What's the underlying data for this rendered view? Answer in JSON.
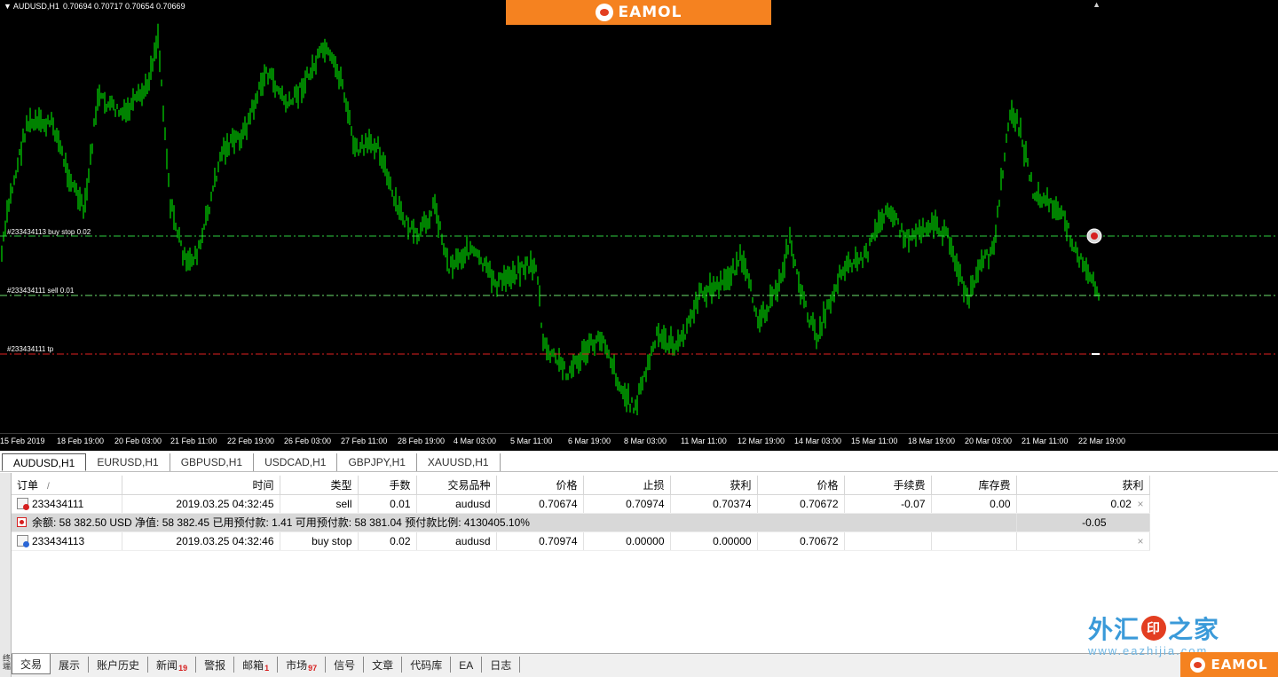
{
  "chart": {
    "symbol_label": "AUDUSD,H1",
    "quote": "0.70694 0.70717 0.70654 0.70669",
    "colors": {
      "background": "#000000",
      "bars": "#00c800",
      "order_line": "#2ecc40",
      "tp_line": "#e02020"
    },
    "order_lines": [
      {
        "label": "#233434113 buy stop 0.02",
        "color": "#2ecc40"
      },
      {
        "label": "#233434111 sell 0.01",
        "color": "#6ee06e"
      },
      {
        "label": "#233434111 tp",
        "color": "#e02020"
      }
    ],
    "time_axis": [
      "15 Feb 2019",
      "18 Feb 19:00",
      "20 Feb 03:00",
      "21 Feb 11:00",
      "22 Feb 19:00",
      "26 Feb 03:00",
      "27 Feb 11:00",
      "28 Feb 19:00",
      "4 Mar 03:00",
      "5 Mar 11:00",
      "6 Mar 19:00",
      "8 Mar 03:00",
      "11 Mar 11:00",
      "12 Mar 19:00",
      "14 Mar 03:00",
      "15 Mar 11:00",
      "18 Mar 19:00",
      "20 Mar 03:00",
      "21 Mar 11:00",
      "22 Mar 19:00"
    ]
  },
  "brand": {
    "name": "EAMOL",
    "color": "#f58220"
  },
  "chart_tabs": [
    "AUDUSD,H1",
    "EURUSD,H1",
    "GBPUSD,H1",
    "USDCAD,H1",
    "GBPJPY,H1",
    "XAUUSD,H1"
  ],
  "terminal": {
    "side_label": "终端",
    "columns": [
      "订单",
      "时间",
      "类型",
      "手数",
      "交易品种",
      "价格",
      "止损",
      "获利",
      "价格",
      "手续费",
      "库存费",
      "获利"
    ],
    "rows": [
      {
        "order": "233434111",
        "time": "2019.03.25 04:32:45",
        "type": "sell",
        "lots": "0.01",
        "symbol": "audusd",
        "open_price": "0.70674",
        "sl": "0.70974",
        "tp": "0.70374",
        "price": "0.70672",
        "commission": "-0.07",
        "swap": "0.00",
        "profit": "0.02",
        "close": "×"
      },
      {
        "order": "233434113",
        "time": "2019.03.25 04:32:46",
        "type": "buy stop",
        "lots": "0.02",
        "symbol": "audusd",
        "open_price": "0.70974",
        "sl": "0.00000",
        "tp": "0.00000",
        "price": "0.70672",
        "commission": "",
        "swap": "",
        "profit": "",
        "close": "×"
      }
    ],
    "summary": {
      "text": "余额: 58 382.50 USD  净值: 58 382.45  已用预付款: 1.41  可用预付款: 58 381.04  预付款比例: 4130405.10%",
      "profit": "-0.05"
    },
    "tabs": [
      {
        "label": "交易",
        "badge": ""
      },
      {
        "label": "展示",
        "badge": ""
      },
      {
        "label": "账户历史",
        "badge": ""
      },
      {
        "label": "新闻",
        "badge": "19"
      },
      {
        "label": "警报",
        "badge": ""
      },
      {
        "label": "邮箱",
        "badge": "1"
      },
      {
        "label": "市场",
        "badge": "97"
      },
      {
        "label": "信号",
        "badge": ""
      },
      {
        "label": "文章",
        "badge": ""
      },
      {
        "label": "代码库",
        "badge": ""
      },
      {
        "label": "EA",
        "badge": ""
      },
      {
        "label": "日志",
        "badge": ""
      }
    ]
  },
  "watermark": {
    "text": "外汇之家",
    "seal": "印",
    "url": "www.eazhijia.com"
  }
}
